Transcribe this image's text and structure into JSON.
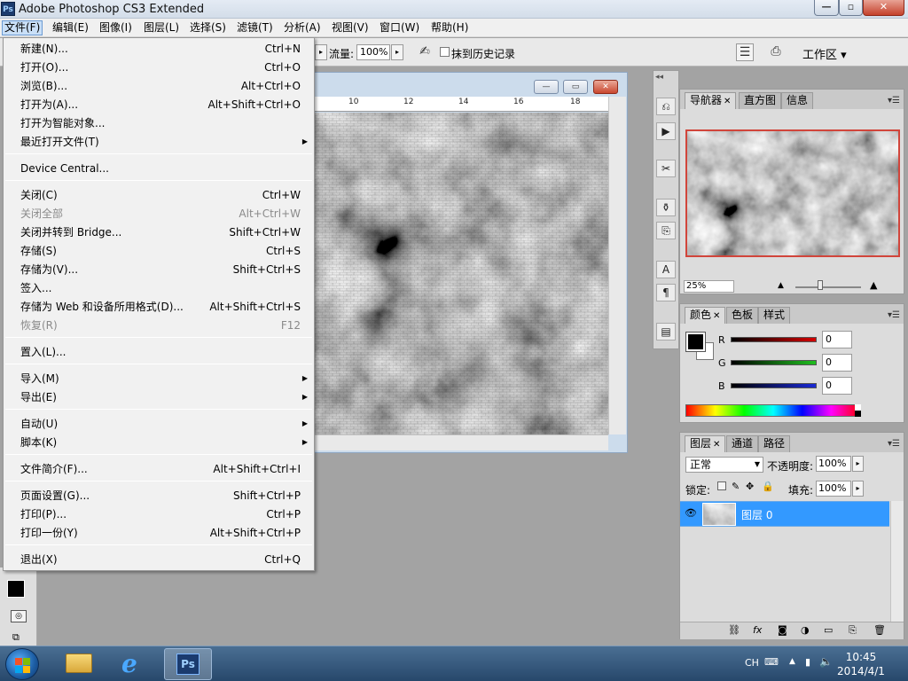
{
  "window": {
    "title": "Adobe Photoshop CS3 Extended",
    "logo": "Ps",
    "controls": {
      "minimize": "—",
      "maximize": "▫",
      "close": "✕"
    }
  },
  "menubar": [
    "文件(F)",
    "编辑(E)",
    "图像(I)",
    "图层(L)",
    "选择(S)",
    "滤镜(T)",
    "分析(A)",
    "视图(V)",
    "窗口(W)",
    "帮助(H)"
  ],
  "options": {
    "flow_label": "流量:",
    "flow_value": "100%",
    "history_label": "抹到历史记录",
    "workspace_label": "工作区 ▾"
  },
  "document": {
    "ruler": [
      "10",
      "12",
      "14",
      "16",
      "18"
    ]
  },
  "file_menu": {
    "items": [
      {
        "label": "新建(N)...",
        "shortcut": "Ctrl+N"
      },
      {
        "label": "打开(O)...",
        "shortcut": "Ctrl+O"
      },
      {
        "label": "浏览(B)...",
        "shortcut": "Alt+Ctrl+O"
      },
      {
        "label": "打开为(A)...",
        "shortcut": "Alt+Shift+Ctrl+O"
      },
      {
        "label": "打开为智能对象...",
        "shortcut": ""
      },
      {
        "label": "最近打开文件(T)",
        "shortcut": "",
        "submenu": true
      },
      {
        "label": "Device Central...",
        "shortcut": ""
      },
      {
        "label": "关闭(C)",
        "shortcut": "Ctrl+W"
      },
      {
        "label": "关闭全部",
        "shortcut": "Alt+Ctrl+W",
        "disabled": true
      },
      {
        "label": "关闭并转到 Bridge...",
        "shortcut": "Shift+Ctrl+W"
      },
      {
        "label": "存储(S)",
        "shortcut": "Ctrl+S"
      },
      {
        "label": "存储为(V)...",
        "shortcut": "Shift+Ctrl+S"
      },
      {
        "label": "签入...",
        "shortcut": ""
      },
      {
        "label": "存储为 Web 和设备所用格式(D)...",
        "shortcut": "Alt+Shift+Ctrl+S"
      },
      {
        "label": "恢复(R)",
        "shortcut": "F12",
        "disabled": true
      },
      {
        "label": "置入(L)...",
        "shortcut": ""
      },
      {
        "label": "导入(M)",
        "shortcut": "",
        "submenu": true
      },
      {
        "label": "导出(E)",
        "shortcut": "",
        "submenu": true
      },
      {
        "label": "自动(U)",
        "shortcut": "",
        "submenu": true
      },
      {
        "label": "脚本(K)",
        "shortcut": "",
        "submenu": true
      },
      {
        "label": "文件简介(F)...",
        "shortcut": "Alt+Shift+Ctrl+I"
      },
      {
        "label": "页面设置(G)...",
        "shortcut": "Shift+Ctrl+P"
      },
      {
        "label": "打印(P)...",
        "shortcut": "Ctrl+P"
      },
      {
        "label": "打印一份(Y)",
        "shortcut": "Alt+Shift+Ctrl+P"
      },
      {
        "label": "退出(X)",
        "shortcut": "Ctrl+Q"
      }
    ]
  },
  "navigator": {
    "tabs": [
      "导航器",
      "直方图",
      "信息"
    ],
    "zoom": "25%"
  },
  "color": {
    "tabs": [
      "颜色",
      "色板",
      "样式"
    ],
    "channels": [
      {
        "label": "R",
        "value": "0",
        "color": "#d40000"
      },
      {
        "label": "G",
        "value": "0",
        "color": "#1fbf1f"
      },
      {
        "label": "B",
        "value": "0",
        "color": "#1a2ad6"
      }
    ]
  },
  "layers": {
    "tabs": [
      "图层",
      "通道",
      "路径"
    ],
    "blend_mode": "正常",
    "opacity_label": "不透明度:",
    "opacity_value": "100%",
    "lock_label": "锁定:",
    "fill_label": "填充:",
    "fill_value": "100%",
    "items": [
      {
        "name": "图层 0",
        "selected": true
      }
    ]
  },
  "taskbar": {
    "lang": "CH",
    "time": "10:45",
    "date": "2014/4/1"
  },
  "colors": {
    "selection": "#3399ff",
    "menu_highlight": "#c9dff7"
  }
}
